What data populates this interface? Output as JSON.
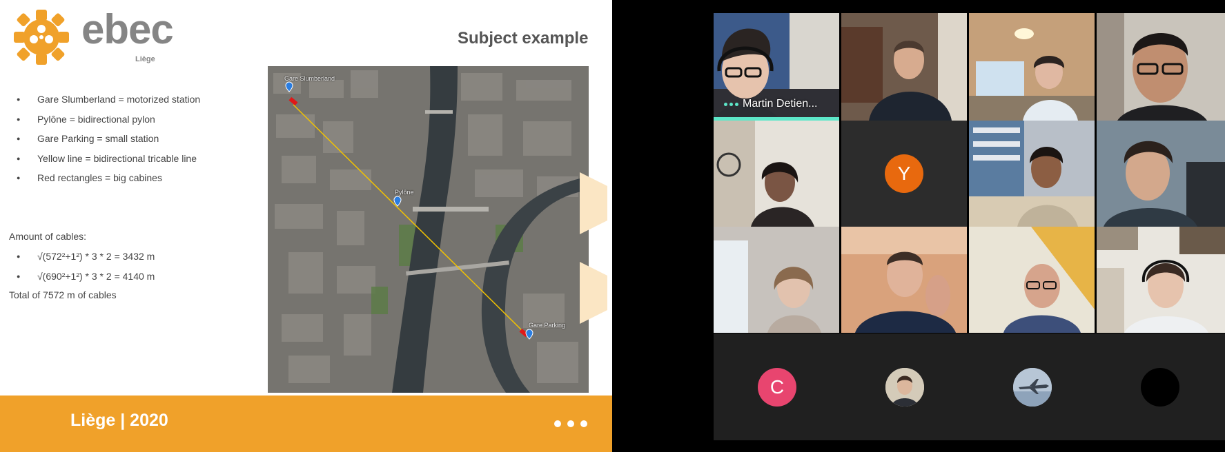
{
  "slide": {
    "logo": {
      "word": "ebec",
      "city": "Liège"
    },
    "title": "Subject example",
    "bullets": [
      "Gare Slumberland = motorized station",
      "Pylône = bidirectional pylon",
      "Gare Parking = small station",
      "Yellow line = bidirectional tricable line",
      "Red rectangles = big cabines"
    ],
    "cables_label": "Amount of cables:",
    "cables": [
      "√(572²+1²) * 3 * 2 = 3432 m",
      "√(690²+1²) * 3 * 2 = 4140 m"
    ],
    "cables_total": "Total of 7572 m of cables",
    "map_labels": {
      "station_a": "Gare Slumberland",
      "pylon": "Pylône",
      "station_b": "Gare Parking"
    },
    "footer": "Liège | 2020",
    "colors": {
      "brand_orange": "#f0a12a",
      "line_yellow": "#f2c200",
      "cabin_red": "#e01818",
      "pin_blue": "#2a7de1"
    }
  },
  "meeting": {
    "active_speaker": "Martin Detien...",
    "avatar_tile_initial": "Y",
    "strip": [
      {
        "initial": "C",
        "color": "#e8456f"
      },
      {
        "initial": "",
        "kind": "photo-person"
      },
      {
        "initial": "",
        "kind": "photo-aircraft"
      },
      {
        "initial": "",
        "kind": "black"
      }
    ],
    "colors": {
      "speaking_accent": "#5de7c9",
      "avatar_orange": "#e8690e"
    }
  }
}
